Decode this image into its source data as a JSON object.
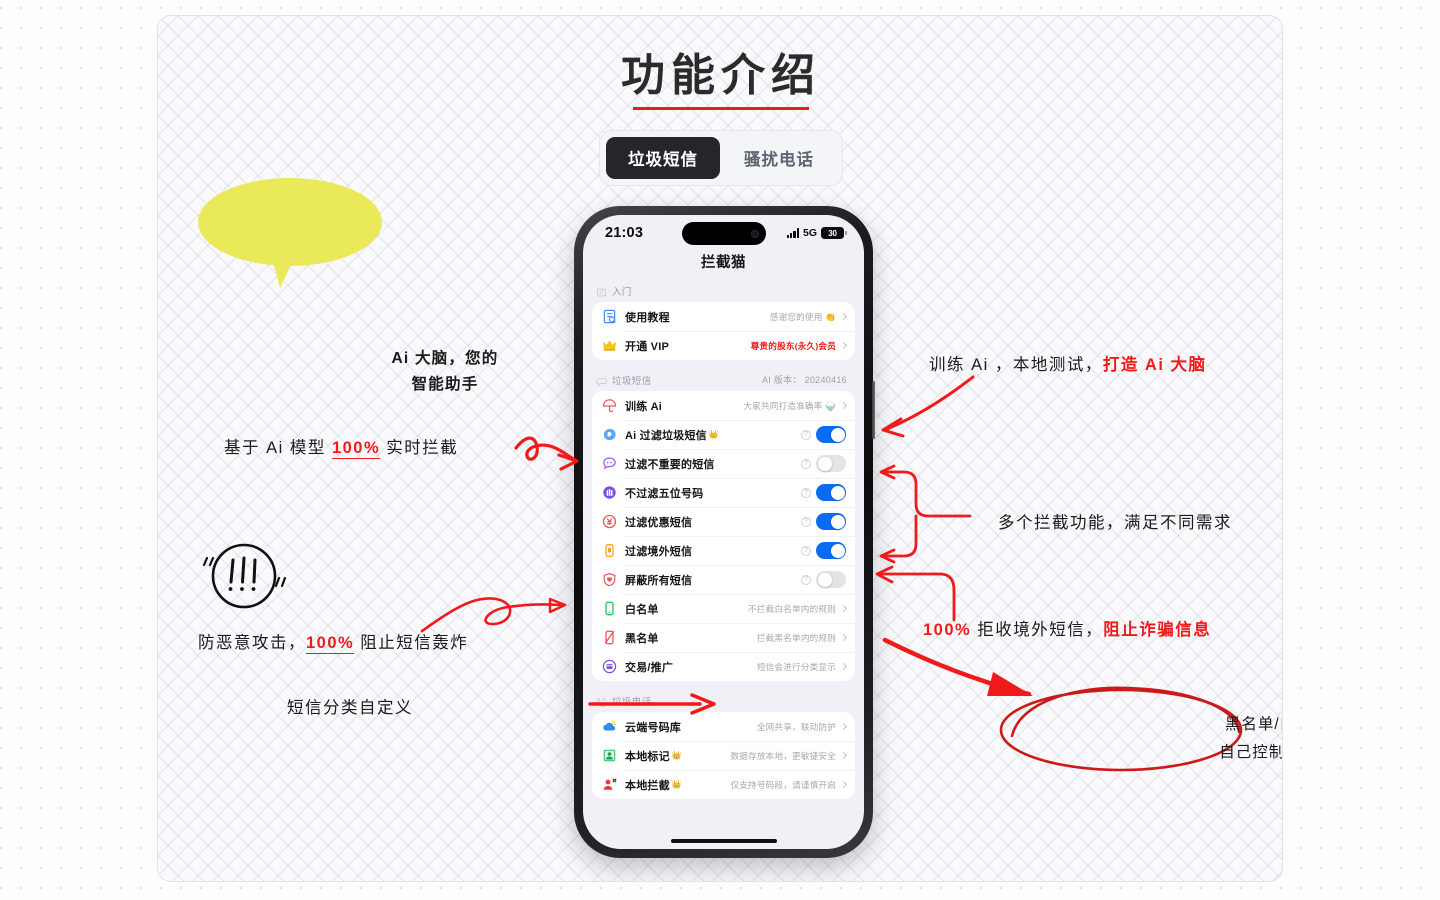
{
  "header": {
    "title": "功能介绍",
    "tabs": [
      {
        "label": "垃圾短信",
        "active": true
      },
      {
        "label": "骚扰电话",
        "active": false
      }
    ]
  },
  "phone": {
    "status_bar": {
      "time": "21:03",
      "network": "5G",
      "battery": "30",
      "signal_icon": "signal-bars-icon"
    },
    "app_title": "拦截猫",
    "sections": [
      {
        "id": "getting-started",
        "icon": "book-icon",
        "title": "入门",
        "right": "",
        "rows": [
          {
            "icon": "tutorial-icon",
            "label": "使用教程",
            "value": "感谢您的使用 👏",
            "type": "chevron",
            "vip": false,
            "crown": false
          },
          {
            "icon": "crown-icon",
            "label": "开通 VIP",
            "value": "尊贵的股东(永久)会员",
            "type": "chevron",
            "vip": true,
            "crown": false
          }
        ]
      },
      {
        "id": "spam-sms",
        "icon": "message-icon",
        "title": "垃圾短信",
        "right": "AI 版本： 20240416",
        "rows": [
          {
            "icon": "umbrella-icon",
            "label": "训练 Ai",
            "value": "大家共同打造准确率 🍚",
            "type": "chevron",
            "vip": false,
            "crown": false
          },
          {
            "icon": "ai-face-icon",
            "label": "Ai 过滤垃圾短信",
            "value": "",
            "type": "toggle-on",
            "vip": false,
            "crown": true
          },
          {
            "icon": "chat-bubble-icon",
            "label": "过滤不重要的短信",
            "value": "",
            "type": "toggle-off",
            "vip": false,
            "crown": false
          },
          {
            "icon": "building-icon",
            "label": "不过滤五位号码",
            "value": "",
            "type": "toggle-on",
            "vip": false,
            "crown": false
          },
          {
            "icon": "yen-icon",
            "label": "过滤优惠短信",
            "value": "",
            "type": "toggle-on",
            "vip": false,
            "crown": false
          },
          {
            "icon": "sim-card-icon",
            "label": "过滤境外短信",
            "value": "",
            "type": "toggle-on",
            "vip": false,
            "crown": false
          },
          {
            "icon": "shield-heart-icon",
            "label": "屏蔽所有短信",
            "value": "",
            "type": "toggle-off",
            "vip": false,
            "crown": false
          },
          {
            "icon": "phone-green-icon",
            "label": "白名单",
            "value": "不拦截白名单内的规则",
            "type": "chevron",
            "vip": false,
            "crown": false
          },
          {
            "icon": "phone-blocked-icon",
            "label": "黑名单",
            "value": "拦截黑名单内的规则",
            "type": "chevron",
            "vip": false,
            "crown": false
          },
          {
            "icon": "transaction-icon",
            "label": "交易/推广",
            "value": "短信会进行分类显示",
            "type": "chevron",
            "vip": false,
            "crown": false
          }
        ]
      },
      {
        "id": "spam-calls",
        "icon": "phone-off-icon",
        "title": "垃圾电话",
        "right": "",
        "rows": [
          {
            "icon": "cloud-icon",
            "label": "云端号码库",
            "value": "全网共享，联动防护",
            "type": "chevron",
            "vip": false,
            "crown": false
          },
          {
            "icon": "local-mark-icon",
            "label": "本地标记",
            "value": "数据存放本地，更敏捷安全",
            "type": "chevron",
            "vip": false,
            "crown": true
          },
          {
            "icon": "local-block-icon",
            "label": "本地拦截",
            "value": "仅支持号码段，请谨慎开启",
            "type": "chevron",
            "vip": false,
            "crown": true
          }
        ]
      }
    ]
  },
  "annotations": {
    "bubble": {
      "line1": "Ai 大脑，您的",
      "line2": "智能助手",
      "color": "#e9e95a"
    },
    "left_1_prefix": "基于 Ai 模型 ",
    "left_1_highlight": "100%",
    "left_1_suffix": " 实时拦截",
    "left_2_prefix": "防恶意攻击，",
    "left_2_highlight": "100%",
    "left_2_suffix": " 阻止短信轰炸",
    "left_3": "短信分类自定义",
    "right_1_prefix": "训练 Ai ，本地测试，",
    "right_1_red": "打造 Ai 大脑",
    "right_2": "多个拦截功能，满足不同需求",
    "right_3_red_prefix": "100%",
    "right_3_mid": " 拒收境外短信，",
    "right_3_red_suffix": "阻止诈骗信息",
    "circle_line1": "黑名单/白名单",
    "circle_line2": "自己控制更放心",
    "accent_red": "#f01a1a"
  }
}
